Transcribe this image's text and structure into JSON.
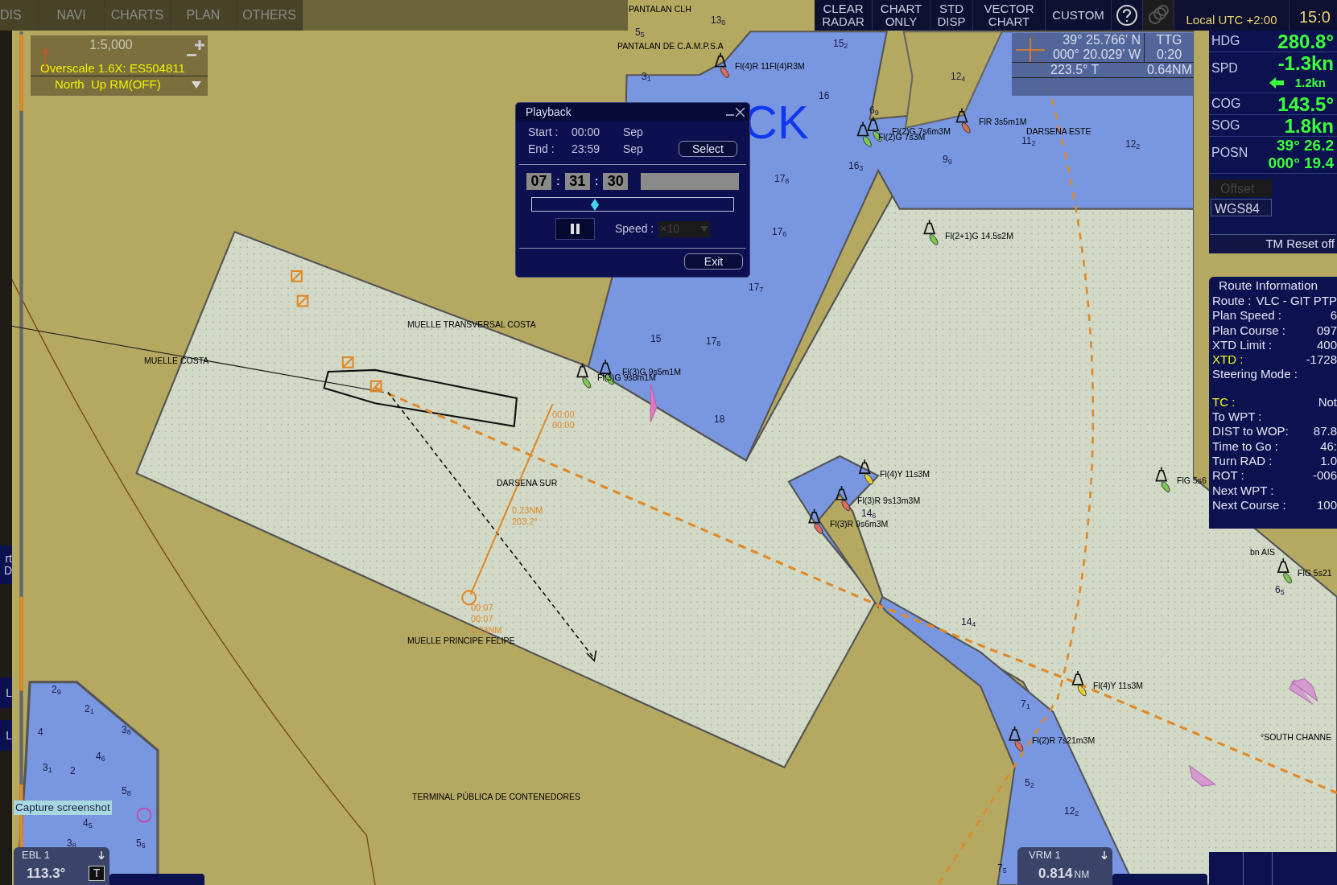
{
  "top_bar": {
    "tabs": [
      {
        "label": "DIS",
        "selected": false
      },
      {
        "label": "NAVI",
        "selected": false
      },
      {
        "label": "CHARTS",
        "selected": false
      },
      {
        "label": "PLAN",
        "selected": false
      },
      {
        "label": "OTHERS",
        "selected": false
      }
    ],
    "buttons": [
      {
        "lines": [
          "CLEAR",
          "RADAR"
        ]
      },
      {
        "lines": [
          "CHART",
          "ONLY"
        ]
      },
      {
        "lines": [
          "STD",
          "DISP"
        ]
      },
      {
        "lines": [
          "VECTOR",
          "CHART"
        ]
      },
      {
        "lines": [
          "CUSTOM"
        ]
      }
    ],
    "timezone": "Local UTC +2:00",
    "time": "15:0"
  },
  "side_buttons": [
    {
      "lines": [
        "rt",
        "D"
      ]
    },
    {
      "lines": [
        "L"
      ]
    },
    {
      "lines": [
        "L"
      ]
    }
  ],
  "scale_box": {
    "scale": "1:5,000",
    "overscale": "Overscale 1.6X: ES504811",
    "orientation": "North  Up RM(OFF)"
  },
  "cursor_info": {
    "lat": "39° 25.766' N",
    "lon": "000° 20.029' W",
    "ttg_label": "TTG",
    "ttg": "0:20",
    "bearing": "223.5° T",
    "range": "0.64NM"
  },
  "nav_panel": {
    "rows": [
      {
        "kind": "single",
        "label": "HDG",
        "value": "280.8°"
      },
      {
        "kind": "speed",
        "label": "SPD",
        "value": "-1.3kn",
        "sub_value": "1.2kn"
      },
      {
        "kind": "single",
        "label": "COG",
        "value": "143.5°"
      },
      {
        "kind": "single",
        "label": "SOG",
        "value": "1.8kn"
      },
      {
        "kind": "position",
        "label": "POSN",
        "value": "39° 26.2",
        "sub_value": "000° 19.4"
      }
    ],
    "offset": {
      "label": "Offset",
      "disabled": true
    },
    "datum": "WGS84",
    "tm_reset": "TM Reset off"
  },
  "playback": {
    "title": "Playback",
    "start_label": "Start :",
    "start_time": "00:00",
    "start_month": "Sep",
    "end_label": "End :",
    "end_time": "23:59",
    "end_month": "Sep",
    "select": "Select",
    "hours": "07",
    "minutes": "31",
    "seconds": "30",
    "separator": ":",
    "level": 0.31,
    "speed_label": "Speed :",
    "speed": {
      "value": "×10",
      "disabled": true
    },
    "exit": "Exit"
  },
  "route_info": {
    "title": "Route Information",
    "route_label": "Route :",
    "route": "VLC - GIT PTP",
    "groups": [
      [
        {
          "label": "Plan Speed :",
          "value": "6",
          "highlight": false
        },
        {
          "label": "Plan Course :",
          "value": "097",
          "highlight": false
        },
        {
          "label": "XTD Limit :",
          "value": "400",
          "highlight": false
        },
        {
          "label": "XTD :",
          "value": "-1728",
          "highlight": true
        },
        {
          "label": "Steering Mode :",
          "highlight": false
        }
      ],
      [
        {
          "label": "TC :",
          "value": "Not",
          "highlight": true
        },
        {
          "label": "To WPT :",
          "highlight": false
        },
        {
          "label": "DIST to WOP:",
          "value": "87.8",
          "highlight": false
        },
        {
          "label": "Time to Go :",
          "value": "46:",
          "highlight": false
        },
        {
          "label": "Turn RAD :",
          "value": "1.0",
          "highlight": false
        },
        {
          "label": "ROT :",
          "value": "-006",
          "highlight": false
        },
        {
          "label": "Next WPT :",
          "highlight": false
        },
        {
          "label": "Next Course :",
          "value": "100",
          "highlight": false
        }
      ]
    ]
  },
  "chart": {
    "mode_text": "CK",
    "places": [
      "PANTALAN CLH",
      "PANTALAN DE C.A.M.P.S.A",
      "MUELLE TRANSVERSAL COSTA",
      "MUELLE COSTA",
      "DARSENA SUR",
      "MUELLE PRINCIPE FELIPE",
      "TERMINAL PÚBLICA DE CONTENEDORES",
      "DARSENA ESTE",
      "°SOUTH CHANNE",
      "bn AIS"
    ],
    "lights": [
      {
        "text": "Fl(4)R 11Fl(4)R3M",
        "color": "#e06a5a"
      },
      {
        "text": "FlR 3s5m1M",
        "color": "#c9764a"
      },
      {
        "text": "Fl(2)G 7s6m3M",
        "color": "#7cc850"
      },
      {
        "text": "Fl(2)G 7s3M",
        "color": "#7cc850"
      },
      {
        "text": "Fl(2+1)G 14.5s2M",
        "color": "#7cc850"
      },
      {
        "text": "Fl(3)G 9s5m1M",
        "color": "#7cc850"
      },
      {
        "text": "Fl(3)G 9s8m1M",
        "color": "#7cc850"
      },
      {
        "text": "Fl(4)Y 11s3M",
        "color": "#e8d030"
      },
      {
        "text": "Fl(3)R 9s13m3M",
        "color": "#e06a5a"
      },
      {
        "text": "Fl(3)R 9s6m3M",
        "color": "#e06a5a"
      },
      {
        "text": "Fl(4)Y 11s3M",
        "color": "#e8d030"
      },
      {
        "text": "Fl(2)R 7s21m3M",
        "color": "#e06a5a"
      },
      {
        "text": "FlG 5s6",
        "color": "#7cc850"
      },
      {
        "text": "FlG 5s21",
        "color": "#7cc850"
      }
    ],
    "route_labels": [
      "00:00",
      "00:00",
      "0.23NM",
      "203.2°",
      "00:07",
      "00:07",
      "0.23NM"
    ],
    "soundings": [
      "13$_{8}$",
      "5$_{5}$",
      "3$_{1}$",
      "15$_{2}$",
      "16",
      "6$_{9}$",
      "9$_{9}$",
      "16$_{3}$",
      "17$_{8}$",
      "11$_{2}$",
      "12$_{2}$",
      "12$_{4}$",
      "17$_{6}$",
      "17$_{7}$",
      "15",
      "17$_{8}$",
      "18",
      "14$_{6}$",
      "14$_{4}$",
      "7$_{1}$",
      "5$_{2}$",
      "12$_{2}$",
      "7$_{5}$",
      "6$_{5}$",
      "2$_{9}$",
      "2$_{1}$",
      "3$_{8}$",
      "4",
      "4$_{6}$",
      "3$_{1}$",
      "2",
      "5$_{8}$",
      "4$_{5}$",
      "3$_{8}$",
      "5$_{6}$"
    ]
  },
  "tooltip": "Capture screenshot",
  "ebl": {
    "label": "EBL 1",
    "value": "113.3°",
    "mode": "T"
  },
  "vrm": {
    "label": "VRM 1",
    "value": "0.814",
    "unit": "NM"
  }
}
